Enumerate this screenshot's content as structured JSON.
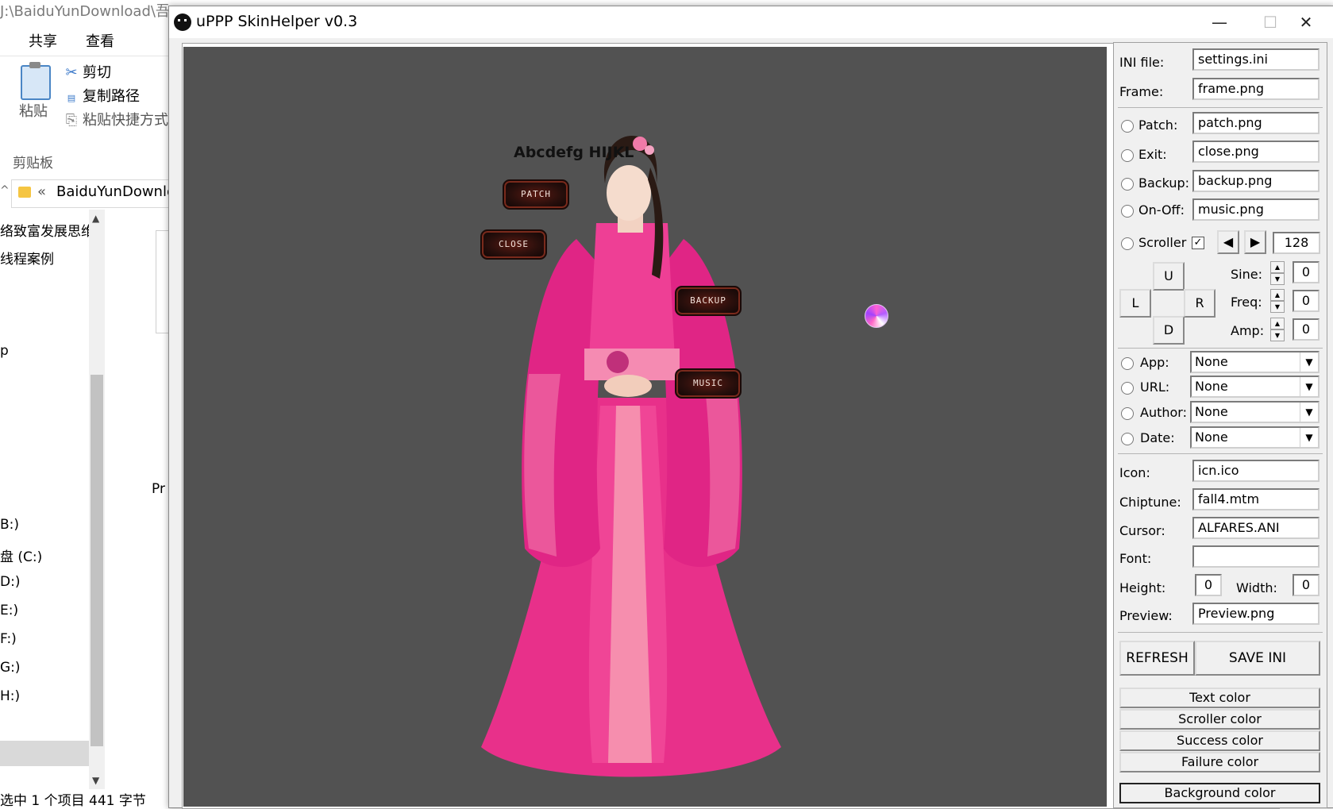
{
  "explorer": {
    "path": "J:\\BaiduYunDownload\\吾",
    "tabs": [
      "共享",
      "查看"
    ],
    "paste_label": "粘贴",
    "cut_label": "剪切",
    "copy_path_label": "复制路径",
    "paste_shortcut_label": "粘贴快捷方式",
    "group_label": "剪贴板",
    "address_chevron": "«",
    "address": "BaiduYunDownlo",
    "nav_items": [
      "络致富发展思维",
      "线程案例",
      "p",
      "B:)",
      "盘 (C:)",
      "D:)",
      "E:)",
      "F:)",
      "G:)",
      "H:)"
    ],
    "item_fragment": "Pr",
    "status": "选中 1 个项目  441 字节"
  },
  "window": {
    "title": "uPPP SkinHelper v0.3",
    "minimize": "—",
    "maximize": "☐",
    "close": "✕"
  },
  "preview": {
    "sample_text": "Abcdefg HIJKL",
    "buttons": {
      "patch": "PATCH",
      "close": "CLOSE",
      "backup": "BACKUP",
      "music": "MUSIC"
    }
  },
  "panel": {
    "ini_label": "INI file:",
    "ini_value": "settings.ini",
    "frame_label": "Frame:",
    "frame_value": "frame.png",
    "patch_label": "Patch:",
    "patch_value": "patch.png",
    "exit_label": "Exit:",
    "exit_value": "close.png",
    "backup_label": "Backup:",
    "backup_value": "backup.png",
    "onoff_label": "On-Off:",
    "onoff_value": "music.png",
    "scroller_label": "Scroller",
    "scroller_checked": true,
    "scroller_left": "◀",
    "scroller_right": "▶",
    "scroller_value": "128",
    "dir_u": "U",
    "dir_l": "L",
    "dir_r": "R",
    "dir_d": "D",
    "sine_label": "Sine:",
    "sine_value": "0",
    "freq_label": "Freq:",
    "freq_value": "0",
    "amp_label": "Amp:",
    "amp_value": "0",
    "app_label": "App:",
    "app_value": "None",
    "url_label": "URL:",
    "url_value": "None",
    "author_label": "Author:",
    "author_value": "None",
    "date_label": "Date:",
    "date_value": "None",
    "icon_label": "Icon:",
    "icon_value": "icn.ico",
    "chiptune_label": "Chiptune:",
    "chiptune_value": "fall4.mtm",
    "cursor_label": "Cursor:",
    "cursor_value": "ALFARES.ANI",
    "font_label": "Font:",
    "font_value": "",
    "height_label": "Height:",
    "height_value": "0",
    "width_label": "Width:",
    "width_value": "0",
    "preview_label": "Preview:",
    "preview_value": "Preview.png",
    "refresh_label": "REFRESH",
    "save_label": "SAVE INI",
    "text_color": "Text color",
    "scroller_color": "Scroller color",
    "success_color": "Success color",
    "failure_color": "Failure color",
    "background_color": "Background color"
  },
  "colors": {
    "preview_bg": "#525252",
    "dress_pink": "#e8308a",
    "button_dark": "#2a0f0c"
  }
}
